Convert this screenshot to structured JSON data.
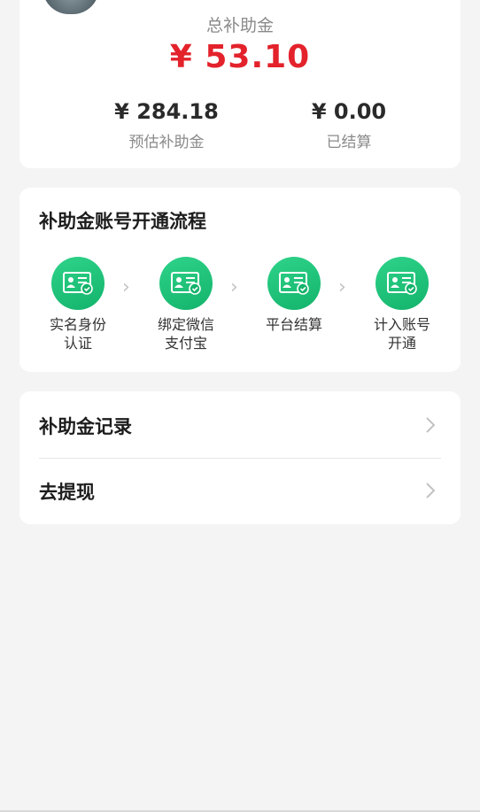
{
  "summary": {
    "total_label": "总补助金",
    "total_amount": "¥ 53.10",
    "estimated_amount": "¥ 284.18",
    "estimated_label": "预估补助金",
    "settled_amount": "¥ 0.00",
    "settled_label": "已结算"
  },
  "process": {
    "title": "补助金账号开通流程",
    "steps": [
      {
        "line1": "实名身份",
        "line2": "认证",
        "icon": "id-card-icon"
      },
      {
        "line1": "绑定微信",
        "line2": "支付宝",
        "icon": "id-card-icon"
      },
      {
        "line1": "平台结算",
        "line2": "",
        "icon": "id-card-icon"
      },
      {
        "line1": "计入账号",
        "line2": "开通",
        "icon": "id-card-icon"
      }
    ]
  },
  "menu": {
    "items": [
      {
        "label": "补助金记录"
      },
      {
        "label": "去提现"
      }
    ]
  },
  "colors": {
    "accent_red": "#e3222b",
    "accent_green": "#13b36b",
    "background": "#f4f4f4"
  }
}
